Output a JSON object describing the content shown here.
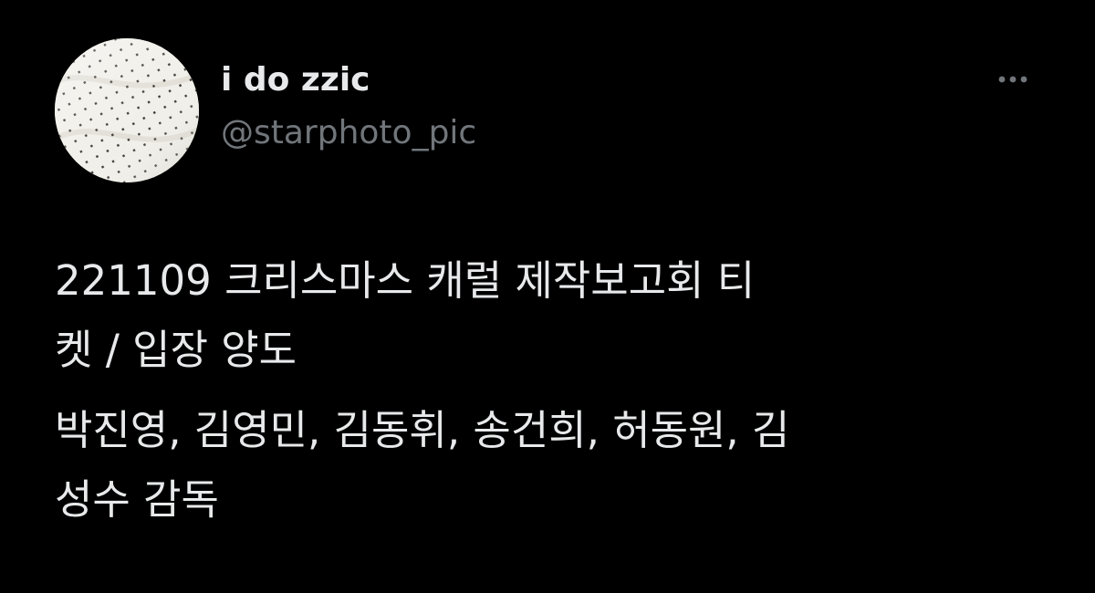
{
  "tweet": {
    "author": {
      "display_name": "i do zzic",
      "handle": "@starphoto_pic",
      "avatar_icon": "dotted-fabric-avatar"
    },
    "more_icon": "more-horizontal-icon",
    "text": {
      "paragraph1": {
        "line1": "221109 크리스마스 캐럴 제작보고회 티",
        "line2": "켓 / 입장 양도"
      },
      "paragraph2": {
        "line1": "박진영, 김영민, 김동휘, 송건희, 허동원, 김",
        "line2": "성수 감독"
      }
    }
  },
  "colors": {
    "background": "#000000",
    "primary_text": "#e7e9ea",
    "secondary_text": "#71767b"
  }
}
